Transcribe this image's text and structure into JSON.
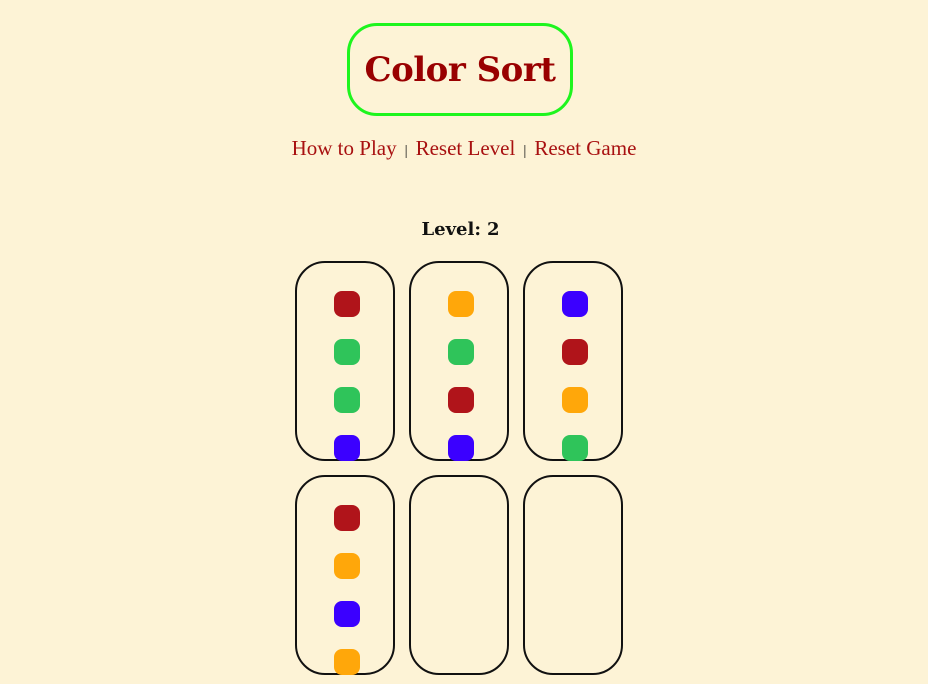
{
  "app": {
    "title": "Color Sort"
  },
  "nav": {
    "how_to_play": "How to Play",
    "reset_level": "Reset Level",
    "reset_game": "Reset Game",
    "separator": "|"
  },
  "level": {
    "label": "Level:",
    "value": "2"
  },
  "colors": {
    "red": "#b0141a",
    "green": "#2fc45a",
    "blue": "#3b00ff",
    "orange": "#ffa70a",
    "title_border": "#1ef51e",
    "title_text": "#990000"
  },
  "tubes": [
    [
      "red",
      "green",
      "green",
      "blue"
    ],
    [
      "orange",
      "green",
      "red",
      "blue"
    ],
    [
      "blue",
      "red",
      "orange",
      "green"
    ],
    [
      "red",
      "orange",
      "blue",
      "orange"
    ],
    [],
    []
  ]
}
